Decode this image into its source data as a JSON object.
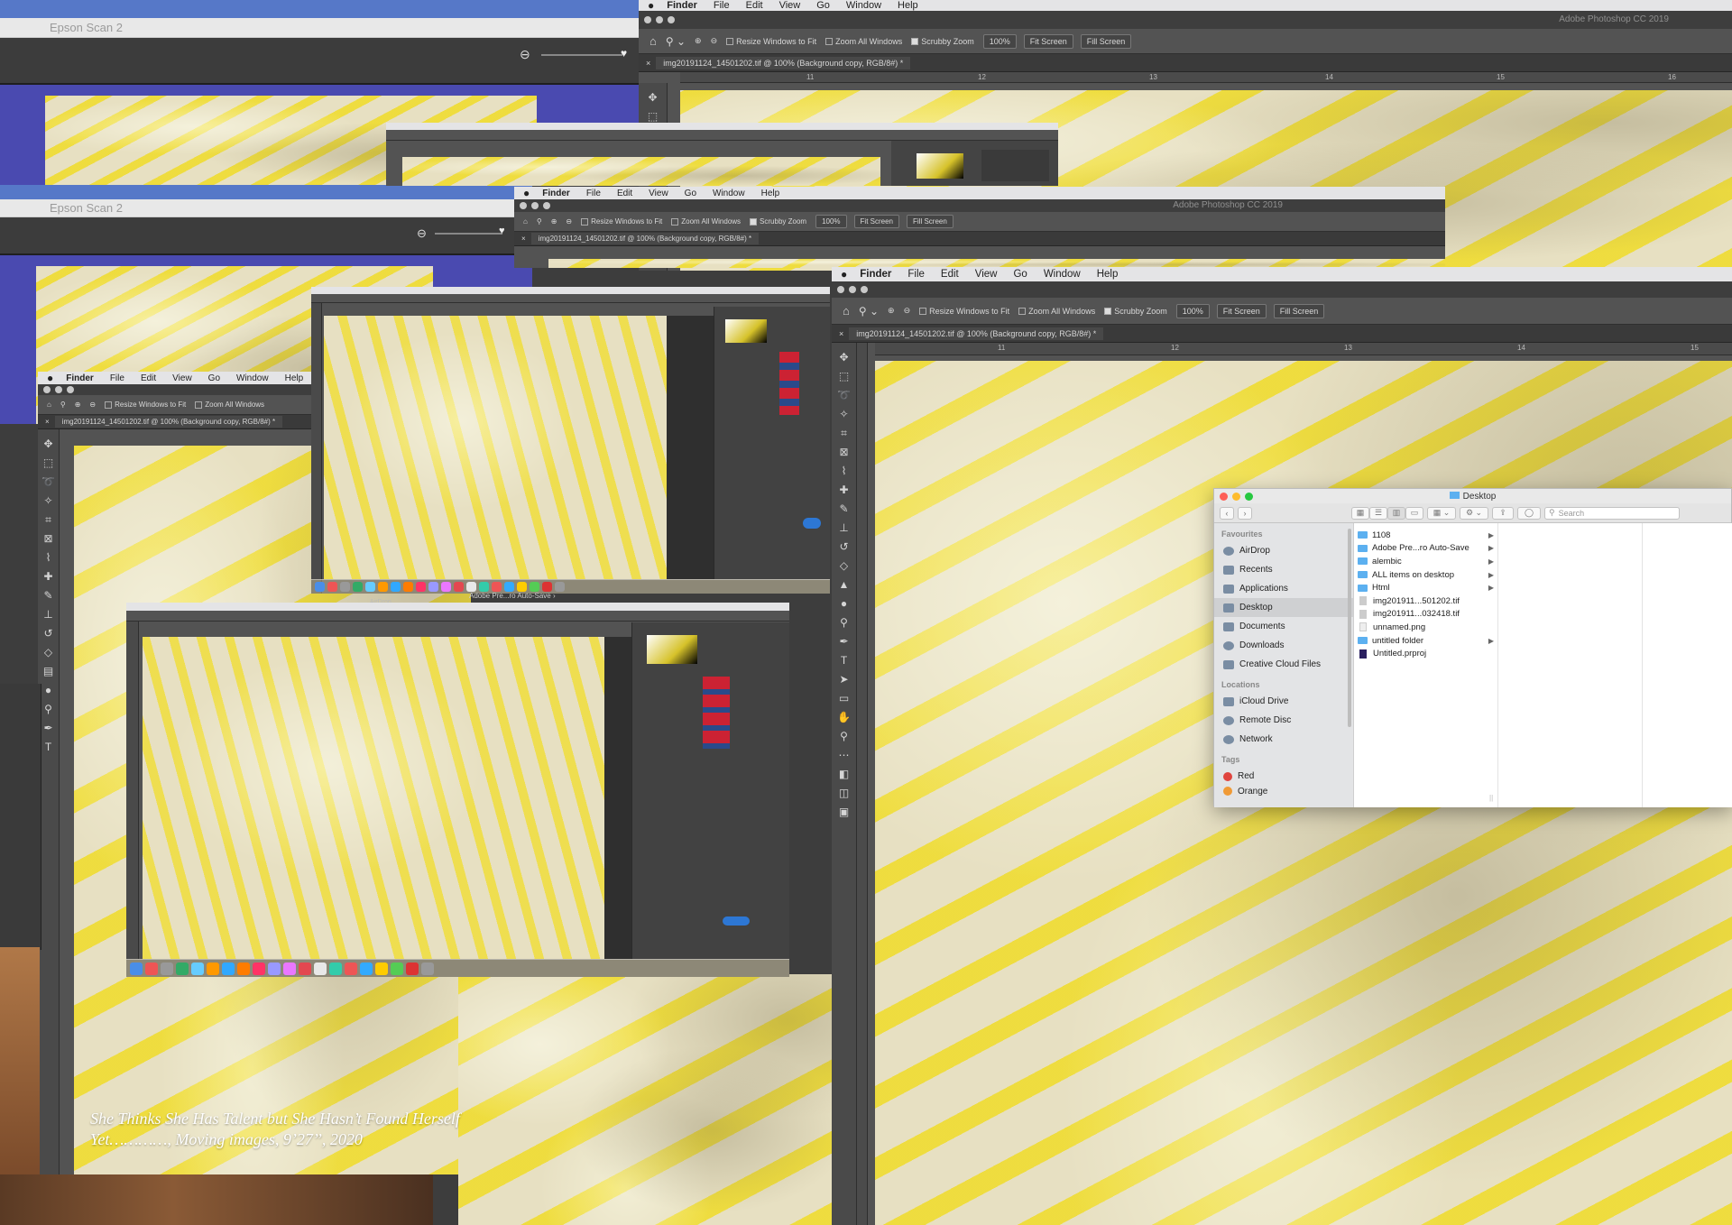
{
  "epson": {
    "title": "Epson Scan 2"
  },
  "menubar": {
    "app": "Finder",
    "items": [
      "File",
      "Edit",
      "View",
      "Go",
      "Window",
      "Help"
    ]
  },
  "photoshop": {
    "app_title": "Adobe Photoshop CC 2019",
    "options": {
      "resize": "Resize Windows to Fit",
      "zoom_all": "Zoom All Windows",
      "scrubby": "Scrubby Zoom",
      "zoom_value": "100%",
      "fit_screen": "Fit Screen",
      "fill_screen": "Fill Screen"
    },
    "doc_tab": "img20191124_14501202.tif @ 100% (Background copy, RGB/8#) *",
    "doc_tab_short": "img20191124_14501202.tif @ 100% (Background copy, RGB/8#) *",
    "ruler_ticks": [
      "11",
      "12",
      "13",
      "14",
      "15",
      "16"
    ]
  },
  "finder": {
    "title": "Desktop",
    "search_placeholder": "Search",
    "sections": {
      "favourites": "Favourites",
      "locations": "Locations",
      "tags": "Tags"
    },
    "favourites": [
      "AirDrop",
      "Recents",
      "Applications",
      "Desktop",
      "Documents",
      "Downloads",
      "Creative Cloud Files"
    ],
    "locations": [
      "iCloud Drive",
      "Remote Disc",
      "Network"
    ],
    "tags": [
      "Red",
      "Orange"
    ],
    "files": [
      {
        "name": "1108",
        "kind": "folder"
      },
      {
        "name": "Adobe Pre...ro Auto-Save",
        "kind": "folder"
      },
      {
        "name": "alembic",
        "kind": "folder"
      },
      {
        "name": "ALL items on desktop",
        "kind": "folder"
      },
      {
        "name": "Html",
        "kind": "folder"
      },
      {
        "name": "img201911...501202.tif",
        "kind": "file"
      },
      {
        "name": "img201911...032418.tif",
        "kind": "file"
      },
      {
        "name": "unnamed.png",
        "kind": "file"
      },
      {
        "name": "untitled folder",
        "kind": "folder"
      },
      {
        "name": "Untitled.prproj",
        "kind": "project"
      }
    ]
  },
  "mid_window": {
    "auto_save": "Adobe Pre...ro Auto-Save",
    "airdrop": "AirDrop"
  },
  "caption": {
    "line1": "She Thinks She Has Talent but She Hasn’t Found Herself",
    "line2": "Yet…………, Moving images, 9’27’’, 2020"
  },
  "colors": {
    "tag_red": "#e0443e",
    "tag_orange": "#f09a36",
    "folder_blue": "#5cb0f0",
    "epson_purple": "#4a4ab0"
  }
}
